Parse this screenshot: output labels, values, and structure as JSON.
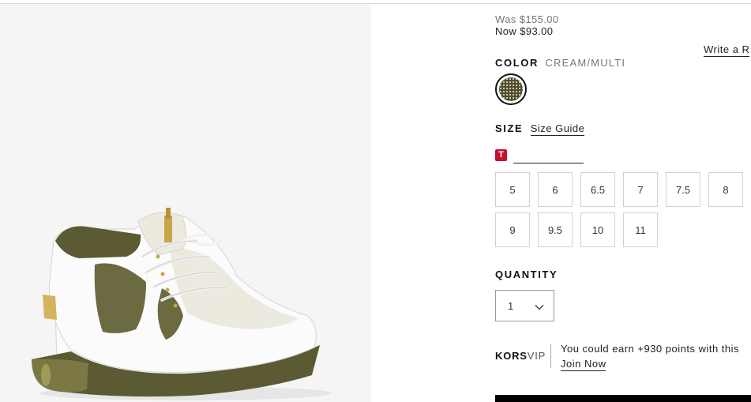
{
  "product": {
    "price_was": "Was $155.00",
    "price_now": "Now $93.00",
    "write_review_label": "Write a R"
  },
  "color": {
    "label": "COLOR",
    "value": "CREAM/MULTI",
    "swatch_icon": "mesh-swatch-icon"
  },
  "size": {
    "label": "SIZE",
    "guide_label": "Size Guide",
    "fit_badge": "T",
    "options": [
      "5",
      "6",
      "6.5",
      "7",
      "7.5",
      "8",
      "9",
      "9.5",
      "10",
      "11"
    ]
  },
  "quantity": {
    "label": "QUANTITY",
    "value": "1"
  },
  "vip": {
    "brand": "KORS",
    "tier": "VIP",
    "message": "You could earn +930 points with this",
    "join_label": "Join Now"
  },
  "colors": {
    "badge_red": "#c8102e",
    "olive": "#5b5a32",
    "cream": "#efece3",
    "gold": "#c9a54a"
  }
}
